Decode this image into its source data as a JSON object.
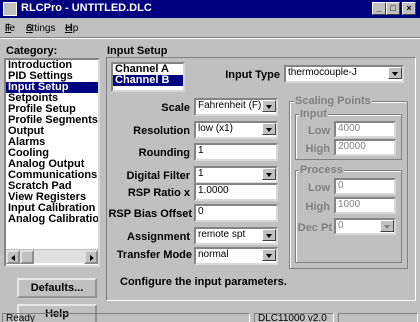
{
  "window": {
    "title": "RLCPro - UNTITLED.DLC",
    "minimize_glyph": "_",
    "maximize_glyph": "□",
    "close_glyph": "×"
  },
  "menu": [
    {
      "label": "File",
      "ul": "F",
      "rest": "ile"
    },
    {
      "label": "Settings",
      "ul": "S",
      "rest": "ettings"
    },
    {
      "label": "Help",
      "ul": "H",
      "rest": "elp"
    }
  ],
  "category": {
    "label": "Category:",
    "items": [
      "Introduction",
      "PID Settings",
      "Input Setup",
      "Setpoints",
      "Profile Setup",
      "Profile Segments",
      "Output",
      "Alarms",
      "Cooling",
      "Analog Output",
      "Communications",
      "Scratch Pad",
      "View Registers",
      "Input Calibration",
      "Analog Calibration"
    ],
    "selected_index": 2
  },
  "buttons": {
    "defaults": "Defaults...",
    "help": "Help"
  },
  "panel": {
    "heading": "Input Setup",
    "channels": [
      "Channel A",
      "Channel B"
    ],
    "selected_channel": 1,
    "input_type_label": "Input Type",
    "input_type_value": "thermocouple-J",
    "scale_label": "Scale",
    "scale_value": "Fahrenheit (F)",
    "resolution_label": "Resolution",
    "resolution_value": "low (x1)",
    "rounding_label": "Rounding",
    "rounding_value": "1",
    "digital_filter_label": "Digital Filter",
    "digital_filter_value": "1",
    "rsp_ratio_label": "RSP Ratio x",
    "rsp_ratio_value": "1.0000",
    "rsp_bias_label": "RSP Bias Offset",
    "rsp_bias_value": "0",
    "assignment_label": "Assignment",
    "assignment_value": "remote spt",
    "transfer_mode_label": "Transfer Mode",
    "transfer_mode_value": "normal",
    "hint": "Configure the input parameters."
  },
  "scaling": {
    "group_label": "Scaling Points",
    "input_label": "Input",
    "low_label": "Low",
    "low_value": "4000",
    "high_label": "High",
    "high_value": "20000",
    "process_label": "Process",
    "proc_low_label": "Low",
    "proc_low_value": "0",
    "proc_high_label": "High",
    "proc_high_value": "1000",
    "dec_pt_label": "Dec Pt",
    "dec_pt_value": "0"
  },
  "status": {
    "left": "Ready",
    "device": "DLC11000 v2.0",
    "extra": ""
  }
}
